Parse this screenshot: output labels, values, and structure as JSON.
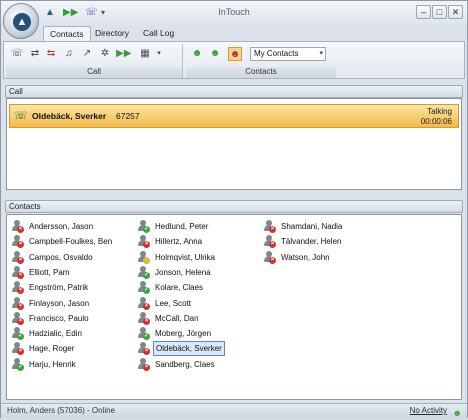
{
  "window": {
    "title": "InTouch"
  },
  "quick_access": [
    "triangle-logo-icon",
    "play-forward-icon",
    "phone-handset-icon",
    "dropdown-arrow-icon"
  ],
  "tabs": [
    {
      "label": "Contacts",
      "active": true
    },
    {
      "label": "Directory",
      "active": false
    },
    {
      "label": "Call Log",
      "active": false
    }
  ],
  "ribbon": {
    "call_group_label": "Call",
    "contacts_group_label": "Contacts",
    "contacts_dropdown_value": "My Contacts",
    "call_icons": [
      "phone-dial-icon",
      "transfer-icon",
      "hold-icon",
      "conference-icon",
      "forward-icon",
      "redial-icon",
      "play-icon",
      "keypad-icon"
    ],
    "contacts_icons": [
      "add-contact-icon",
      "edit-contact-icon",
      "filter-contacts-icon"
    ]
  },
  "call_section": {
    "header": "Call",
    "active_call": {
      "name": "Oldebäck, Sverker",
      "number": "67257",
      "status": "Talking",
      "duration": "00:00:06"
    }
  },
  "contacts_section": {
    "header": "Contacts",
    "contacts": [
      {
        "name": "Andersson, Jason",
        "status": "busy"
      },
      {
        "name": "Campbell-Foulkes, Ben",
        "status": "busy"
      },
      {
        "name": "Campos, Osvaldo",
        "status": "busy"
      },
      {
        "name": "Elliott, Pam",
        "status": "busy"
      },
      {
        "name": "Engström, Patrik",
        "status": "busy"
      },
      {
        "name": "Finlayson, Jason",
        "status": "busy"
      },
      {
        "name": "Francisco, Paulo",
        "status": "busy"
      },
      {
        "name": "Hadzialic, Edin",
        "status": "avail"
      },
      {
        "name": "Hage, Roger",
        "status": "busy"
      },
      {
        "name": "Harju, Henrik",
        "status": "avail"
      },
      {
        "name": "Hedlund, Peter",
        "status": "avail"
      },
      {
        "name": "Hillertz, Anna",
        "status": "busy"
      },
      {
        "name": "Holmqvist, Ulrika",
        "status": "away"
      },
      {
        "name": "Jonson, Helena",
        "status": "avail"
      },
      {
        "name": "Kolare, Claes",
        "status": "avail"
      },
      {
        "name": "Lee, Scott",
        "status": "busy"
      },
      {
        "name": "McCall, Dan",
        "status": "busy"
      },
      {
        "name": "Moberg, Jörgen",
        "status": "avail"
      },
      {
        "name": "Oldebäck, Sverker",
        "status": "busy",
        "selected": true
      },
      {
        "name": "Sandberg, Claes",
        "status": "busy"
      },
      {
        "name": "Shamdani, Nadia",
        "status": "busy"
      },
      {
        "name": "Tälvander, Helen",
        "status": "busy"
      },
      {
        "name": "Watson, John",
        "status": "busy"
      }
    ]
  },
  "statusbar": {
    "user": "Holm, Anders (57036) - Online",
    "activity": "No Activity"
  },
  "colors": {
    "call_highlight": "#f4b94a",
    "busy": "#d0312d",
    "available": "#3ea43e",
    "away": "#e3b52b",
    "selection": "#dbe8fb"
  }
}
